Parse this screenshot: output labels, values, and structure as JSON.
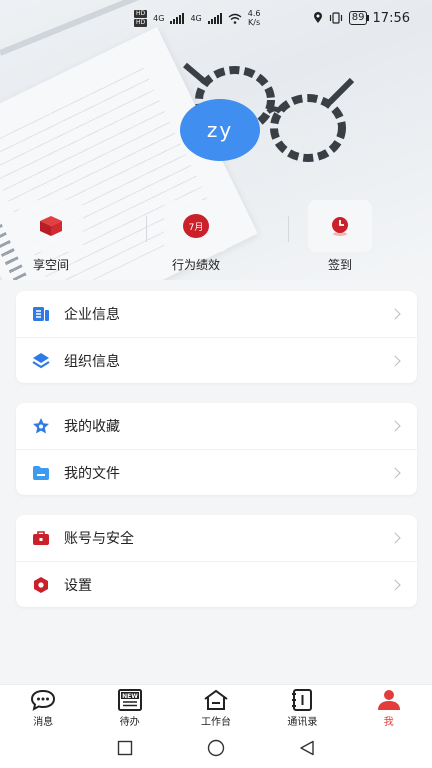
{
  "status_bar": {
    "net1": "4G",
    "net2": "4G",
    "speed_value": "4.6",
    "speed_unit": "K/s",
    "battery": "89",
    "time": "17:56"
  },
  "profile": {
    "avatar_text": "zy",
    "avatar_color": "#3f8ef0"
  },
  "quick_actions": [
    {
      "label": "享空间",
      "icon": "box-icon"
    },
    {
      "label": "行为绩效",
      "icon": "calendar-7-icon",
      "badge": "7月"
    },
    {
      "label": "签到",
      "icon": "clock-pin-icon"
    }
  ],
  "menu": {
    "group1": [
      {
        "label": "企业信息",
        "icon": "company-icon"
      },
      {
        "label": "组织信息",
        "icon": "layers-icon"
      }
    ],
    "group2": [
      {
        "label": "我的收藏",
        "icon": "star-icon"
      },
      {
        "label": "我的文件",
        "icon": "folder-icon"
      }
    ],
    "group3": [
      {
        "label": "账号与安全",
        "icon": "briefcase-lock-icon"
      },
      {
        "label": "设置",
        "icon": "settings-hex-icon"
      }
    ]
  },
  "bottom_nav": [
    {
      "label": "消息",
      "icon": "chat-icon"
    },
    {
      "label": "待办",
      "icon": "new-icon"
    },
    {
      "label": "工作台",
      "icon": "home-icon"
    },
    {
      "label": "通讯录",
      "icon": "contacts-icon"
    },
    {
      "label": "我",
      "icon": "person-icon",
      "active": true
    }
  ],
  "colors": {
    "accent_red": "#e33c3c",
    "icon_blue": "#2f7ae5",
    "icon_red": "#c9202a"
  }
}
